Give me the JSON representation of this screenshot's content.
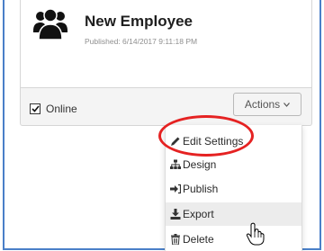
{
  "card": {
    "title": "New Employee",
    "published": "Published: 6/14/2017 9:11:18 PM",
    "online_label": "Online",
    "online_checked": true,
    "icon": "people-icon"
  },
  "actions_button": {
    "label": "Actions",
    "icon": "chevron-down-icon"
  },
  "menu": {
    "items": [
      {
        "label": "Edit Settings",
        "icon": "pencil-icon"
      },
      {
        "label": "Design",
        "icon": "sitemap-icon"
      },
      {
        "label": "Publish",
        "icon": "publish-icon"
      },
      {
        "label": "Export",
        "icon": "download-icon",
        "hover": true
      },
      {
        "label": "Delete",
        "icon": "trash-icon"
      }
    ]
  },
  "annotation": {
    "highlighted_item": "Edit Settings",
    "color": "#e52222"
  },
  "colors": {
    "frame": "#4a7fc8",
    "card_footer": "#f4f4f4"
  }
}
